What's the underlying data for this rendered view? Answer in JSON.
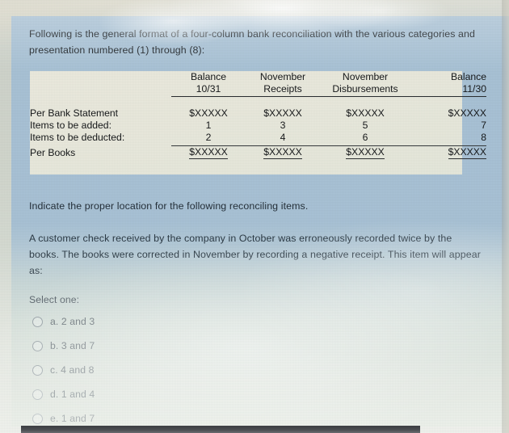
{
  "intro": {
    "text": "Following is the general format of a four-column bank reconciliation with the various categories and presentation numbered (1) through (8):"
  },
  "reconciliation_table": {
    "headers": [
      {
        "line1": "",
        "line2": ""
      },
      {
        "line1": "Balance",
        "line2": "10/31"
      },
      {
        "line1": "November",
        "line2": "Receipts"
      },
      {
        "line1": "November",
        "line2": "Disbursements"
      },
      {
        "line1": "Balance",
        "line2": "11/30"
      }
    ],
    "rows": [
      {
        "label": "Per Bank Statement",
        "v1": "$XXXXX",
        "v2": "$XXXXX",
        "v3": "$XXXXX",
        "v4": "$XXXXX",
        "underline": false
      },
      {
        "label": "Items to be added:",
        "v1": "1",
        "v2": "3",
        "v3": "5",
        "v4": "7",
        "underline": false
      },
      {
        "label": "Items to be deducted:",
        "v1": "2",
        "v2": "4",
        "v3": "6",
        "v4": "8",
        "underline": false
      },
      {
        "label": "Per Books",
        "v1": "$XXXXX",
        "v2": "$XXXXX",
        "v3": "$XXXXX",
        "v4": "$XXXXX",
        "underline": true
      }
    ]
  },
  "instruction": {
    "text": "Indicate the proper location for the following reconciling items."
  },
  "question": {
    "text": "A customer check received by the company in October was erroneously recorded twice by the books. The books were corrected in November by recording a negative receipt. This item will appear as:"
  },
  "answers": {
    "prompt": "Select one:",
    "options": [
      {
        "label": "a. 2 and 3"
      },
      {
        "label": "b. 3 and 7"
      },
      {
        "label": "c. 4 and 8"
      },
      {
        "label": "d. 1 and 4"
      },
      {
        "label": "e. 1 and 7"
      }
    ]
  },
  "colors": {
    "page_background": "#a9c2d6",
    "table_background": "#eceade",
    "text_primary": "#20262b",
    "text_secondary": "#49545c",
    "rule": "#33373a",
    "bottom_bar": "#3c3e42"
  }
}
